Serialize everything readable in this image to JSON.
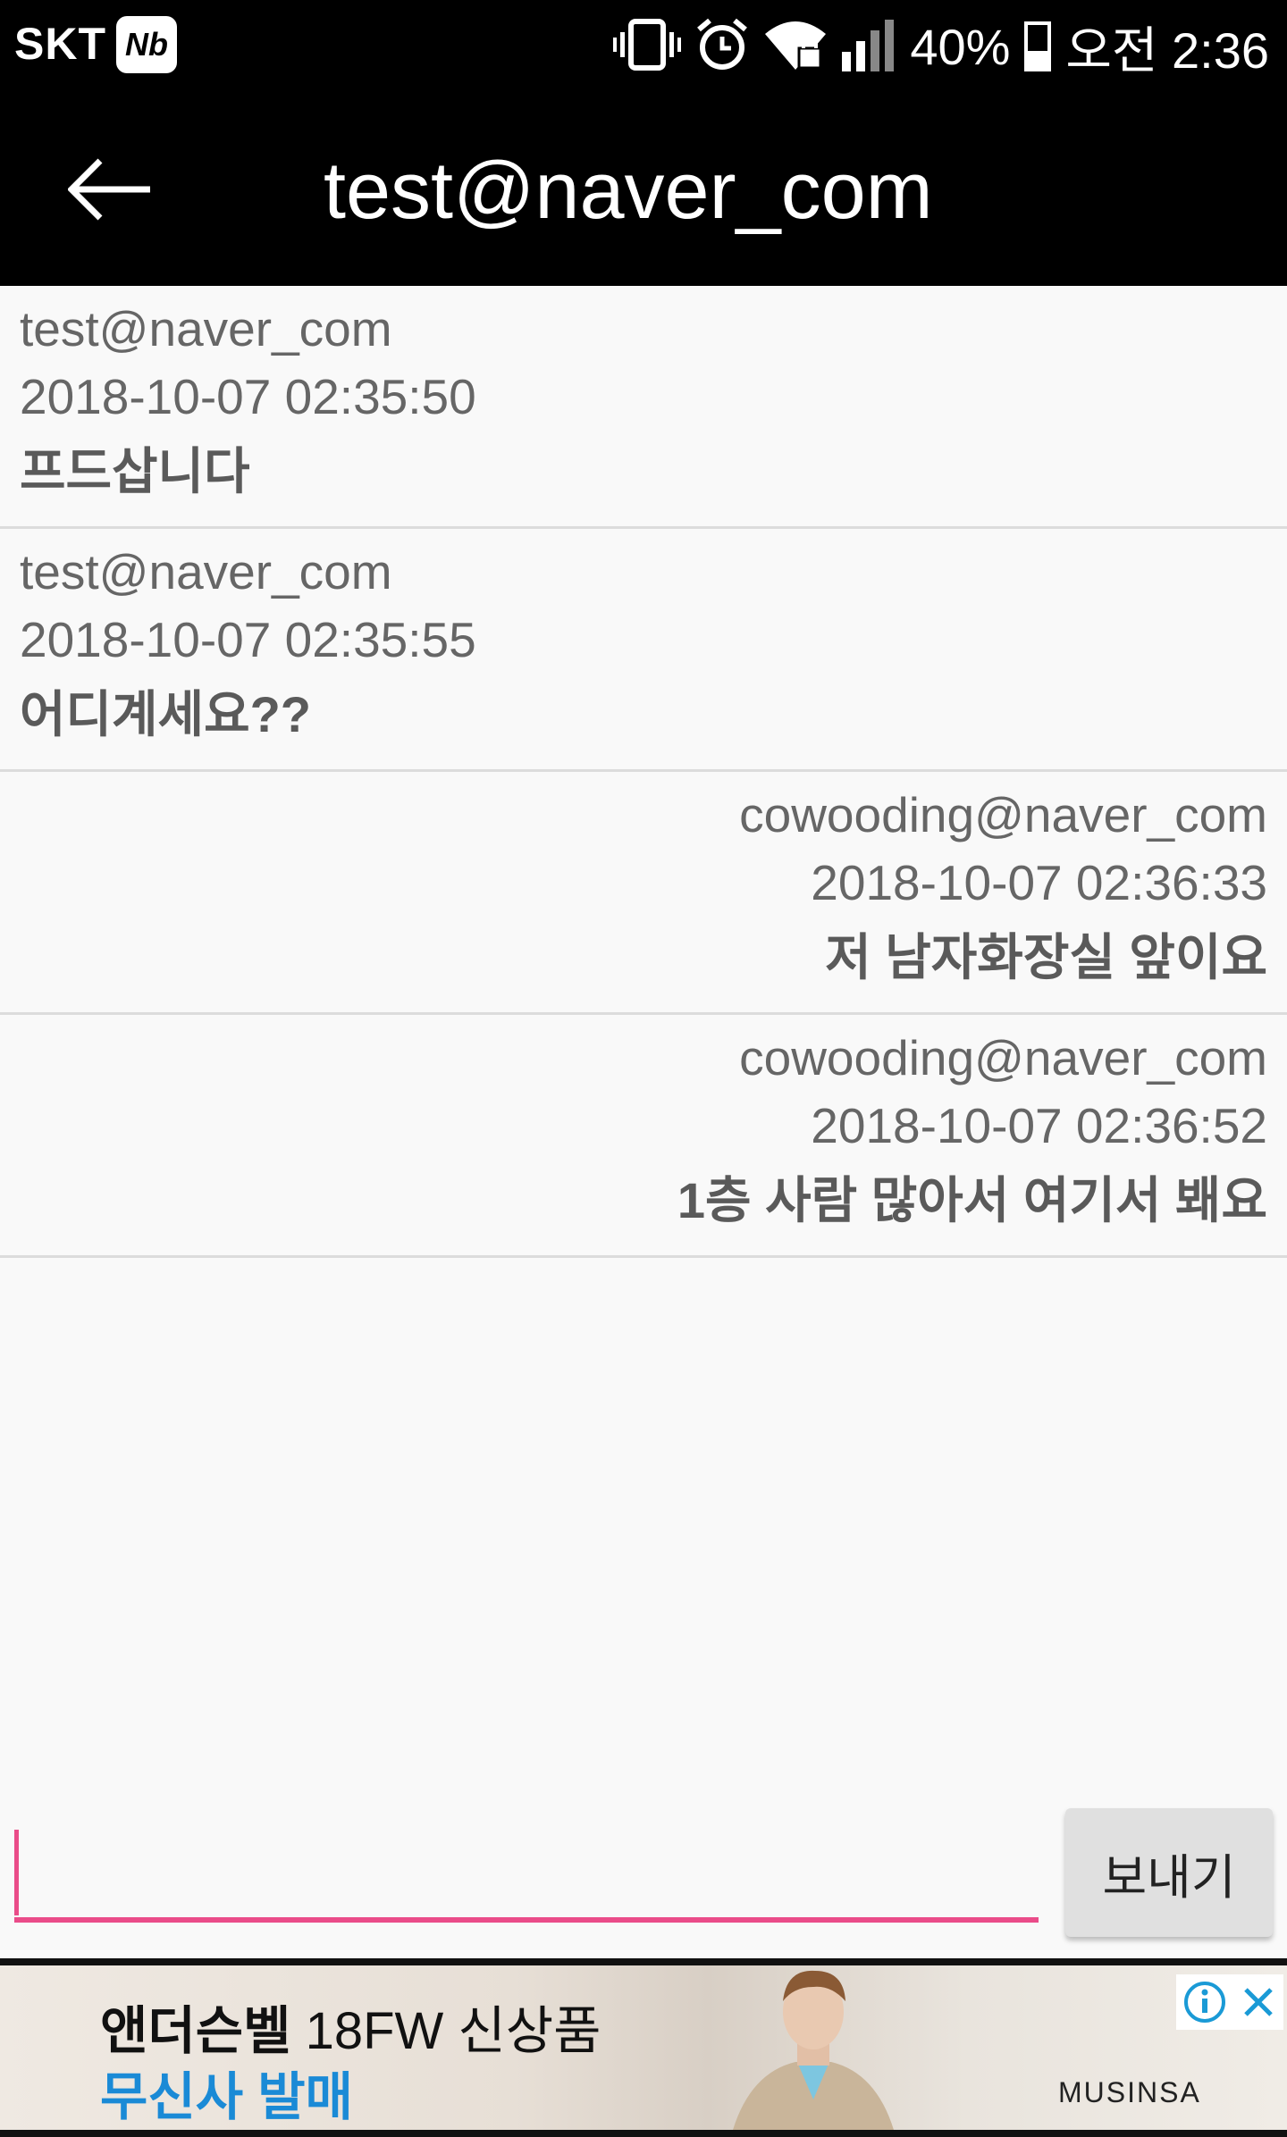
{
  "status_bar": {
    "carrier": "SKT",
    "carrier_badge": "Nb",
    "battery_percent": "40%",
    "battery_level": 0.4,
    "time": "오전 2:36",
    "icons": [
      "vibrate-icon",
      "alarm-icon",
      "wifi-lock-icon",
      "signal-icon",
      "battery-icon"
    ]
  },
  "app_bar": {
    "title": "test@naver_com",
    "back_icon": "back-arrow-icon"
  },
  "messages": [
    {
      "sender": "test@naver_com",
      "time": "2018-10-07 02:35:50",
      "text": "프드삽니다",
      "align": "left"
    },
    {
      "sender": "test@naver_com",
      "time": "2018-10-07 02:35:55",
      "text": "어디계세요??",
      "align": "left"
    },
    {
      "sender": "cowooding@naver_com",
      "time": "2018-10-07 02:36:33",
      "text": "저 남자화장실 앞이요",
      "align": "right"
    },
    {
      "sender": "cowooding@naver_com",
      "time": "2018-10-07 02:36:52",
      "text": "1층 사람 많아서 여기서 봬요",
      "align": "right"
    }
  ],
  "composer": {
    "value": "",
    "send_label": "보내기"
  },
  "ad": {
    "line1_bold": "앤더슨벨",
    "line1_rest": " 18FW 신상품",
    "line2": "무신사 발매",
    "brand": "MUSINSA"
  },
  "colors": {
    "accent": "#ea4c89",
    "ad_link": "#1a8ad6",
    "bar": "#000000"
  }
}
